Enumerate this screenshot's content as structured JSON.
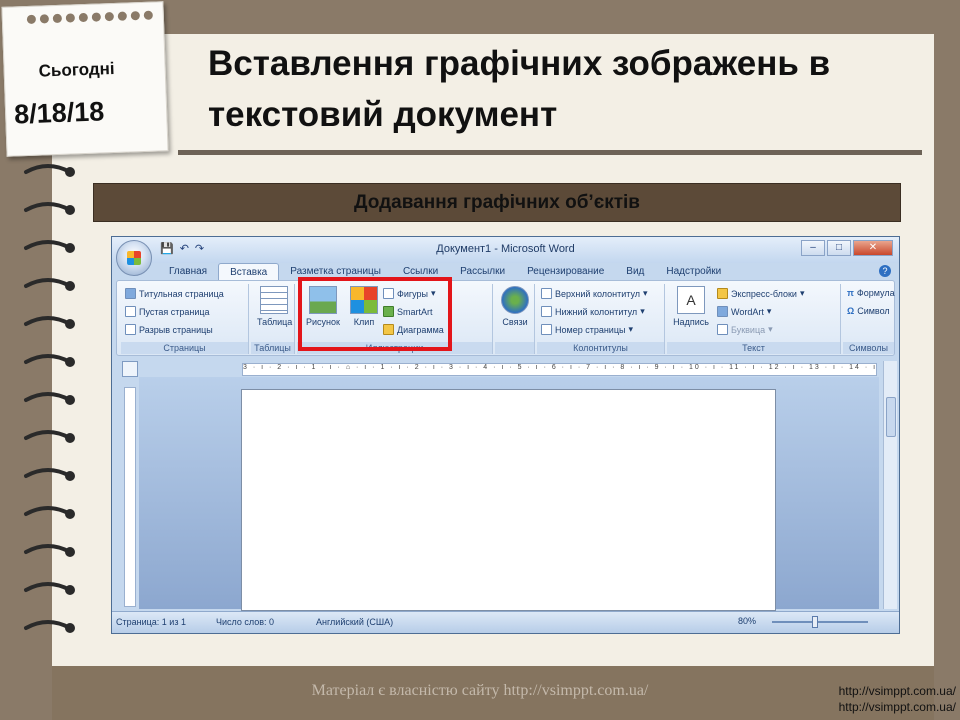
{
  "slide": {
    "today_label": "Сьогодні",
    "date": "8/18/18",
    "title": "Вставлення графічних зображень в текстовий документ",
    "subtitle": "Додавання графічних об’єктів",
    "watermark": "Матеріал є власністю сайту http://vsimppt.com.ua/",
    "url_1": "http://vsimppt.com.ua/",
    "url_2": "http://vsimppt.com.ua/"
  },
  "word": {
    "window_title": "Документ1 - Microsoft Word",
    "tabs": [
      "Главная",
      "Вставка",
      "Разметка страницы",
      "Ссылки",
      "Рассылки",
      "Рецензирование",
      "Вид",
      "Надстройки"
    ],
    "active_tab": "Вставка",
    "groups": {
      "pages": {
        "label": "Страницы",
        "items": [
          "Титульная страница",
          "Пустая страница",
          "Разрыв страницы"
        ]
      },
      "tables": {
        "label": "Таблицы",
        "button": "Таблица"
      },
      "illustrations": {
        "label": "Иллюстрации",
        "picture": "Рисунок",
        "clip": "Клип",
        "shapes": "Фигуры",
        "smartart": "SmartArt",
        "chart": "Диаграмма"
      },
      "links": {
        "label": "",
        "button": "Связи"
      },
      "headers": {
        "label": "Колонтитулы",
        "items": [
          "Верхний колонтитул",
          "Нижний колонтитул",
          "Номер страницы"
        ]
      },
      "text": {
        "label": "Текст",
        "textbox": "Надпись",
        "items": [
          "Экспресс-блоки",
          "WordArt",
          "Буквица"
        ]
      },
      "symbols": {
        "label": "Символы",
        "items": [
          "Формула",
          "Символ"
        ]
      }
    },
    "ruler_text": "3 · ı · 2 · ı · 1 · ı · ⌂ · ı · 1 · ı · 2 · ı · 3 · ı · 4 · ı · 5 · ı · 6 · ı · 7 · ı · 8 · ı · 9 · ı · 10 · ı · 11 · ı · 12 · ı · 13 · ı · 14 · ı · 15 · ı · 16 · ⌂ · 17 · ı",
    "status": {
      "page": "Страница: 1 из 1",
      "words": "Число слов: 0",
      "language": "Английский (США)",
      "zoom": "80%"
    }
  },
  "colors": {
    "highlight": "#e3151a",
    "background": "#8a7a68",
    "subtitle_bar": "#5c4a38"
  },
  "icons": [
    "office-button-icon",
    "save-icon",
    "undo-icon",
    "redo-icon",
    "help-icon",
    "picture-icon",
    "clip-icon",
    "shapes-icon",
    "smartart-icon",
    "chart-icon",
    "table-icon",
    "links-icon",
    "textbox-icon",
    "formula-icon",
    "symbol-icon"
  ]
}
